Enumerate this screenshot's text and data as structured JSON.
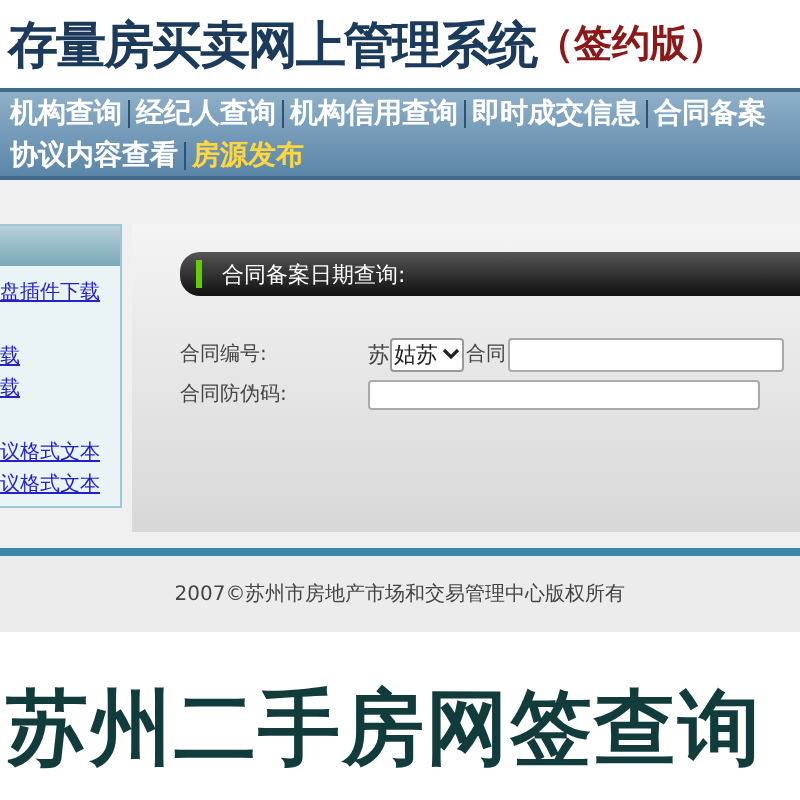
{
  "header": {
    "title": "存量房买卖网上管理系统",
    "edition": "（签约版）"
  },
  "nav_rows": [
    [
      {
        "label": "机构查询",
        "selected": false
      },
      {
        "label": "经纪人查询",
        "selected": false
      },
      {
        "label": "机构信用查询",
        "selected": false
      },
      {
        "label": "即时成交信息",
        "selected": false
      },
      {
        "label": "合同备案",
        "selected": false
      }
    ],
    [
      {
        "label": "协议内容查看",
        "selected": false
      },
      {
        "label": "房源发布",
        "selected": true
      }
    ]
  ],
  "sidebar": {
    "links": [
      "盘插件下载",
      "载",
      "载",
      "议格式文本",
      "议格式文本"
    ]
  },
  "panel": {
    "title": "合同备案日期查询:",
    "contract_no": {
      "label": "合同编号:",
      "prefix": "苏",
      "district": "姑苏",
      "middle": "合同"
    },
    "security_code": {
      "label": "合同防伪码:"
    }
  },
  "footer": {
    "copyright": "2007©苏州市房地产市场和交易管理中心版权所有"
  },
  "caption": "苏州二手房网签查询"
}
